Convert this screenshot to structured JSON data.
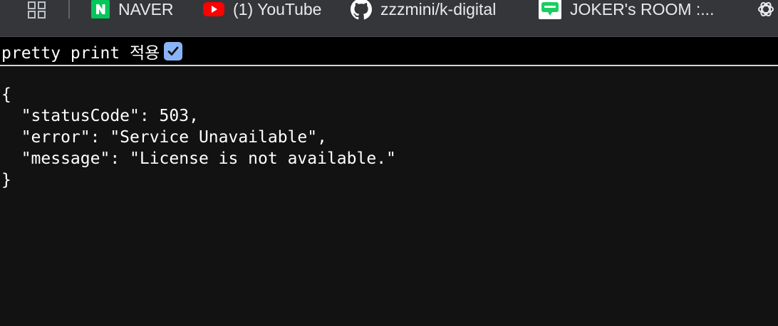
{
  "bookmarks": [
    {
      "label": "NAVER",
      "icon": "naver-icon"
    },
    {
      "label": "(1) YouTube",
      "icon": "youtube-icon"
    },
    {
      "label": "zzzmini/k-digital",
      "icon": "github-icon"
    },
    {
      "label": "JOKER's ROOM :...",
      "icon": "joker-blog-icon"
    }
  ],
  "pretty_print": {
    "label": "pretty print 적용",
    "checked": true
  },
  "json_lines": [
    "{",
    "  \"statusCode\": 503,",
    "  \"error\": \"Service Unavailable\",",
    "  \"message\": \"License is not available.\"",
    "}"
  ],
  "colors": {
    "naver": "#03c75a",
    "youtube": "#ff0000",
    "checkbox": "#8ab4f8",
    "background": "#121212"
  }
}
